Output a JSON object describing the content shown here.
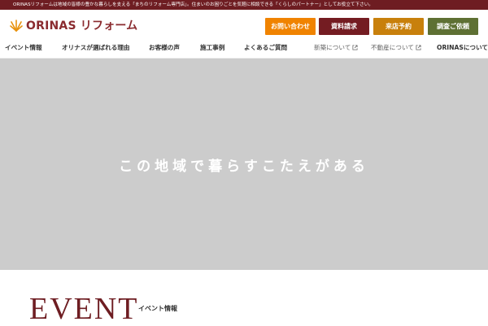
{
  "topbar": {
    "text": "ORINASリフォームは地域の皆様の豊かな暮らしを支える「まちのリフォーム専門店」。住まいのお困りごとを気軽に相談できる「くらしのパートナー」としてお役立て下さい。"
  },
  "header": {
    "logo_text": "ORINAS リフォーム",
    "buttons": {
      "contact": "お問い合わせ",
      "docs": "資料請求",
      "visit": "来店予約",
      "survey": "調査ご依頼"
    }
  },
  "nav": {
    "items": [
      "イベント情報",
      "オリナスが選ばれる理由",
      "お客様の声",
      "施工事例",
      "よくあるご質問",
      "新築について",
      "不動産について",
      "ORINASについて"
    ]
  },
  "hero": {
    "tagline": "この地域で暮らすこたえがある"
  },
  "event": {
    "title": "EVENT",
    "subtitle": "イベント情報"
  },
  "colors": {
    "brand": "#6e1d22",
    "contact": "#f08300",
    "docs": "#741c22",
    "visit": "#c8800c",
    "survey": "#5e7033",
    "hero_bg": "#cccccc"
  },
  "icons": {
    "logo": "sunburst-logo-icon",
    "external": "external-link-icon"
  }
}
